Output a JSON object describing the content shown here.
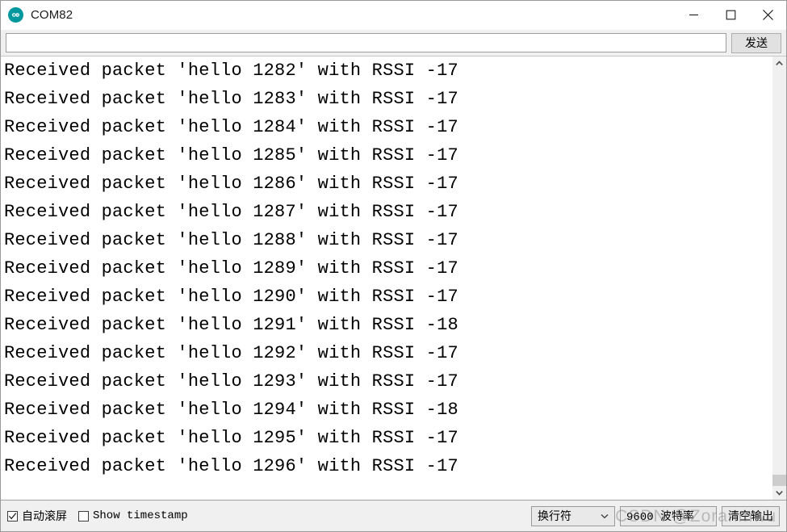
{
  "window": {
    "title": "COM82",
    "app_icon": "arduino-logo-icon",
    "accent_color": "#00979d",
    "controls": {
      "minimize": "minimize-icon",
      "maximize": "maximize-icon",
      "close": "close-icon"
    }
  },
  "send_row": {
    "input_value": "",
    "input_placeholder": "",
    "send_label": "发送"
  },
  "console": {
    "lines": [
      "Received packet 'hello 1282' with RSSI -17",
      "Received packet 'hello 1283' with RSSI -17",
      "Received packet 'hello 1284' with RSSI -17",
      "Received packet 'hello 1285' with RSSI -17",
      "Received packet 'hello 1286' with RSSI -17",
      "Received packet 'hello 1287' with RSSI -17",
      "Received packet 'hello 1288' with RSSI -17",
      "Received packet 'hello 1289' with RSSI -17",
      "Received packet 'hello 1290' with RSSI -17",
      "Received packet 'hello 1291' with RSSI -18",
      "Received packet 'hello 1292' with RSSI -17",
      "Received packet 'hello 1293' with RSSI -17",
      "Received packet 'hello 1294' with RSSI -18",
      "Received packet 'hello 1295' with RSSI -17",
      "Received packet 'hello 1296' with RSSI -17"
    ]
  },
  "scrollbar": {
    "up_icon": "chevron-up-icon",
    "down_icon": "chevron-down-icon",
    "position": "bottom"
  },
  "statusbar": {
    "autoscroll": {
      "label": "自动滚屏",
      "checked": true,
      "icon": "checkmark-icon"
    },
    "timestamp": {
      "label": "Show timestamp",
      "checked": false
    },
    "line_ending": {
      "value": "换行符",
      "arrow_icon": "chevron-down-icon"
    },
    "baud_rate": {
      "value": "9600 波特率"
    },
    "clear_label": "清空输出"
  },
  "watermark": {
    "text": "CSDN @Zoranmwu"
  }
}
